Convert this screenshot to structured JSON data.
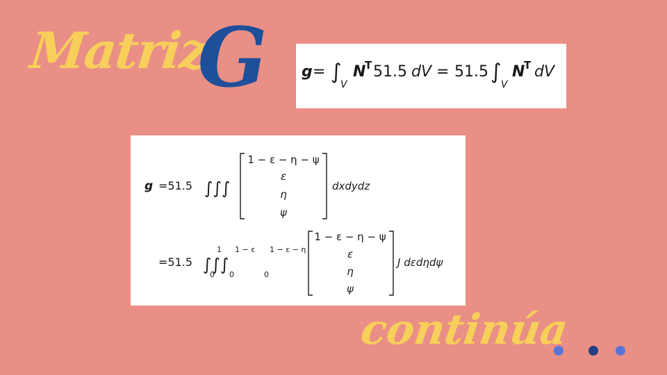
{
  "slide": {
    "title_word": "Matriz",
    "title_letter": "G",
    "footer": "continúa"
  },
  "equation_1": {
    "lhs": "g",
    "equals": "=",
    "integral": "∫",
    "domain": "V",
    "transpose_term": "N",
    "superscript": "T",
    "mid_factor": "51.5",
    "differential": "dV",
    "equals_2": "=",
    "coefficient": "51.5"
  },
  "equation_2": {
    "lhs": "g",
    "row1_prefix": "=51.5",
    "triple_integral": "∫∫∫",
    "vector": [
      "1 − ε − η − ψ",
      "ε",
      "η",
      "ψ"
    ],
    "row1_differential": "dxdydz",
    "row2_prefix": "=51.5",
    "limits": [
      {
        "upper": "1",
        "lower": "0"
      },
      {
        "upper": "1 − ε",
        "lower": "0"
      },
      {
        "upper": "1 − ε − η",
        "lower": "0"
      }
    ],
    "row2_differential": "J dεdηdψ"
  },
  "colors": {
    "background": "#e98f85",
    "script_yellow": "#f7cf5a",
    "title_blue": "#1e4f9a",
    "dot_light_blue": "#5a74d8",
    "dot_dark_blue": "#233f86"
  }
}
